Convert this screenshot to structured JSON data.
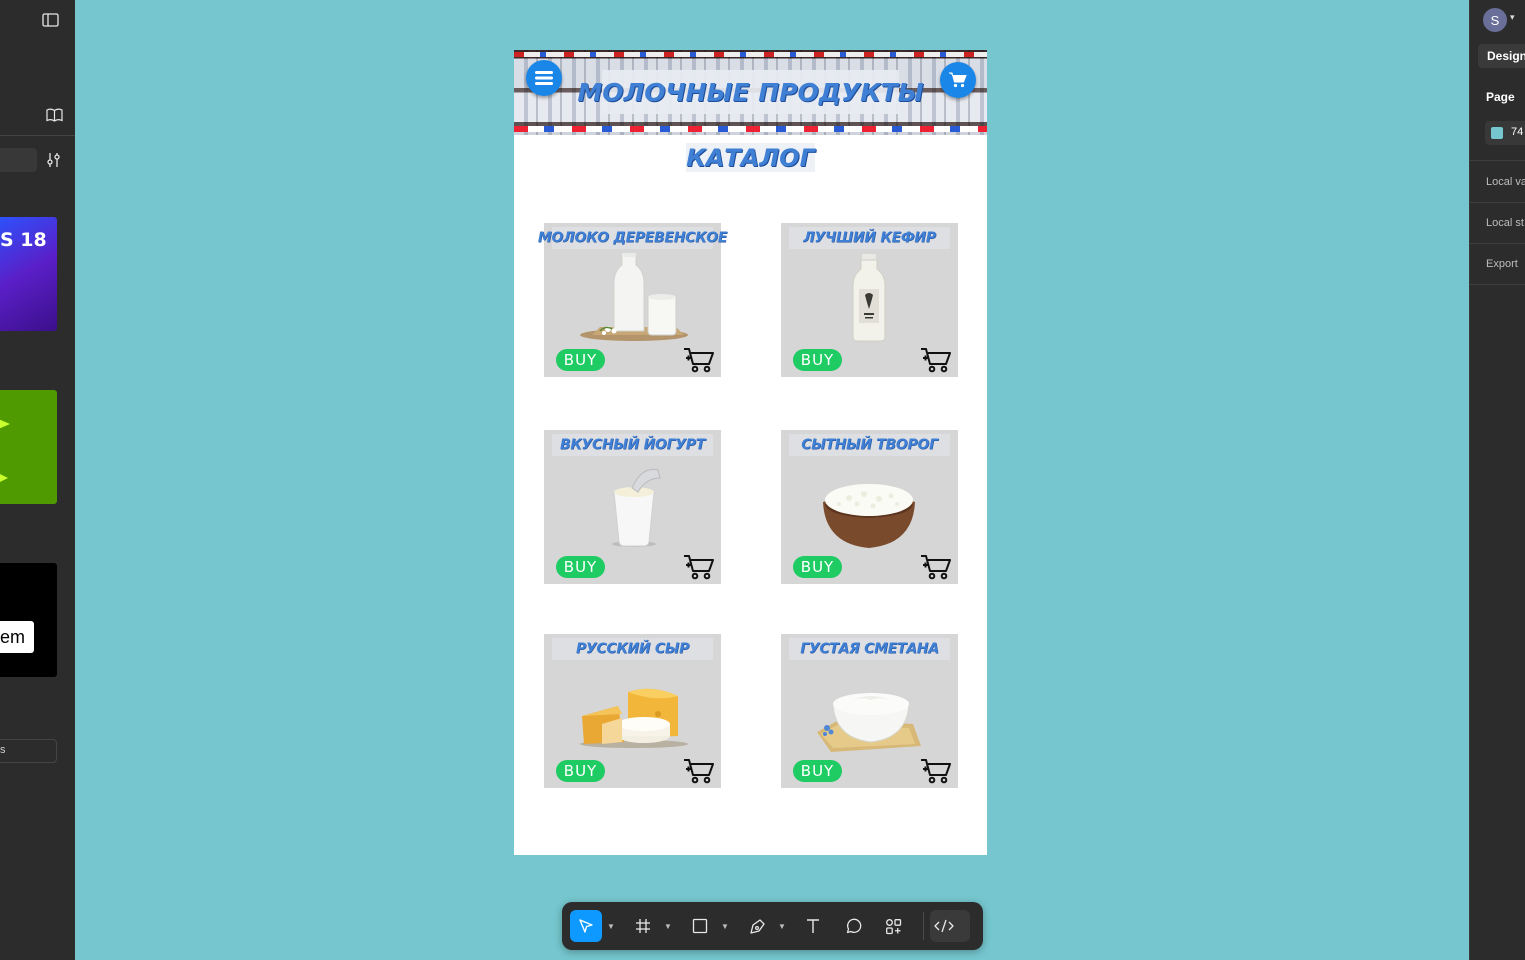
{
  "canvas": {
    "background": "#75c6ce"
  },
  "left_panel": {
    "thumbnails": [
      {
        "name": "thumb-ios",
        "text": "S 18"
      },
      {
        "name": "thumb-green"
      },
      {
        "name": "thumb-black",
        "text": "em"
      }
    ],
    "field_text": "s"
  },
  "right_panel": {
    "avatar_initial": "S",
    "design_tab": "Design",
    "page_label": "Page",
    "page_color_value": "74",
    "page_color": "#75c6ce",
    "local_variables": "Local va",
    "local_styles": "Local st",
    "export": "Export"
  },
  "app": {
    "hero_title": "МОЛОЧНЫЕ ПРОДУКТЫ",
    "catalog_title": "КАТАЛОГ",
    "buy_color": "#1fcb63",
    "accent_color": "#1a86e8",
    "products": [
      {
        "title": "МОЛОКО ДЕРЕВЕНСКОЕ",
        "buy": "BUY",
        "image": "milk-bottle-and-glass"
      },
      {
        "title": "ЛУЧШИЙ КЕФИР",
        "buy": "BUY",
        "image": "kefir-bottle"
      },
      {
        "title": "ВКУСНЫЙ ЙОГУРТ",
        "buy": "BUY",
        "image": "yogurt-cup"
      },
      {
        "title": "СЫТНЫЙ ТВОРОГ",
        "buy": "BUY",
        "image": "cottage-cheese-bowl"
      },
      {
        "title": "РУССКИЙ СЫР",
        "buy": "BUY",
        "image": "cheese-pieces"
      },
      {
        "title": "ГУСТАЯ СМЕТАНА",
        "buy": "BUY",
        "image": "sour-cream-bowl"
      }
    ]
  },
  "toolbar": {
    "tools": [
      "move-icon",
      "frame-icon",
      "rectangle-icon",
      "pen-icon",
      "text-icon",
      "comment-icon",
      "actions-icon",
      "dev-mode-icon"
    ]
  }
}
